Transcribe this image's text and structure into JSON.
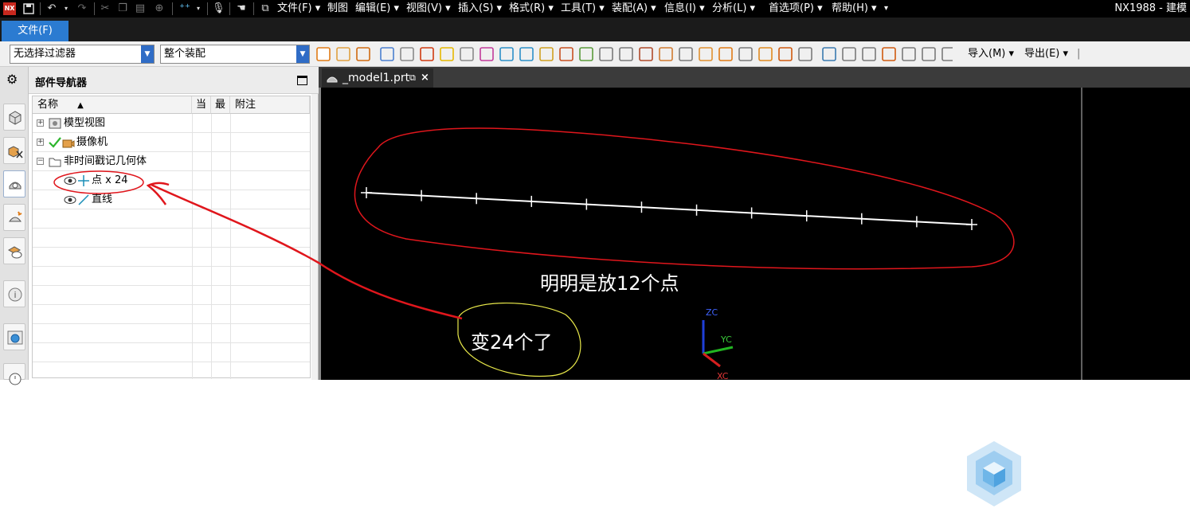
{
  "app": {
    "logo_text": "NX",
    "window_title": "NX1988 - 建模"
  },
  "menu": {
    "items": [
      {
        "label": "文件(F)"
      },
      {
        "label": "制图"
      },
      {
        "label": "编辑(E)"
      },
      {
        "label": "视图(V)"
      },
      {
        "label": "插入(S)"
      },
      {
        "label": "格式(R)"
      },
      {
        "label": "工具(T)"
      },
      {
        "label": "装配(A)"
      },
      {
        "label": "信息(I)"
      },
      {
        "label": "分析(L)"
      },
      {
        "label": "首选项(P)"
      },
      {
        "label": "帮助(H)"
      }
    ]
  },
  "ribbon": {
    "file_tab_label": "文件(F)"
  },
  "toolbar": {
    "filter_value": "无选择过滤器",
    "scope_value": "整个装配",
    "import_label": "导入(M)",
    "export_label": "导出(E)"
  },
  "navigator": {
    "title": "部件导航器",
    "columns": [
      "名称",
      "当",
      "最",
      "附注"
    ],
    "sort_indicator": "▲",
    "rows": [
      {
        "label": "模型视图",
        "expander": "+",
        "icon": "model-views-icon"
      },
      {
        "label": "摄像机",
        "expander": "+",
        "icon": "camera-icon"
      },
      {
        "label": "非时间戳记几何体",
        "expander": "−",
        "icon": "folder-icon"
      },
      {
        "label": "点 x 24",
        "icon": "point-icon"
      },
      {
        "label": "直线",
        "icon": "line-icon"
      }
    ]
  },
  "graphics": {
    "tab_label": "_model1.prt",
    "triad": {
      "zc": "ZC",
      "yc": "YC",
      "xc": "XC"
    }
  },
  "annotations": {
    "note_main": "明明是放12个点",
    "note_callout": "变24个了"
  },
  "colors": {
    "annotation_red": "#e0161c",
    "annotation_yellow": "#e8e84a",
    "accent_blue": "#2b7bd1",
    "point_check": "#2db52d"
  }
}
